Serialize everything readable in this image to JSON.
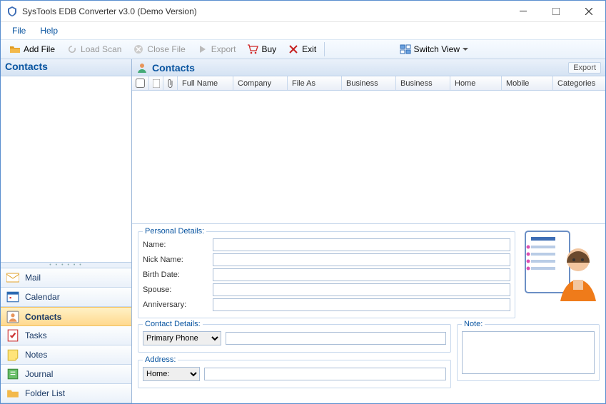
{
  "window": {
    "title": "SysTools EDB Converter v3.0 (Demo Version)"
  },
  "menu": {
    "file": "File",
    "help": "Help"
  },
  "toolbar": {
    "add_file": "Add File",
    "load_scan": "Load Scan",
    "close_file": "Close File",
    "export": "Export",
    "buy": "Buy",
    "exit": "Exit",
    "switch_view": "Switch View"
  },
  "left": {
    "header": "Contacts",
    "nav": [
      {
        "label": "Mail",
        "icon": "mail-icon"
      },
      {
        "label": "Calendar",
        "icon": "calendar-icon"
      },
      {
        "label": "Contacts",
        "icon": "contacts-icon",
        "selected": true
      },
      {
        "label": "Tasks",
        "icon": "tasks-icon"
      },
      {
        "label": "Notes",
        "icon": "notes-icon"
      },
      {
        "label": "Journal",
        "icon": "journal-icon"
      },
      {
        "label": "Folder List",
        "icon": "folder-icon"
      }
    ]
  },
  "right": {
    "header": "Contacts",
    "export_btn": "Export",
    "columns": {
      "full_name": "Full Name",
      "company": "Company",
      "file_as": "File As",
      "business1": "Business",
      "business2": "Business",
      "home": "Home",
      "mobile": "Mobile",
      "categories": "Categories"
    }
  },
  "details": {
    "personal_legend": "Personal Details:",
    "name": "Name:",
    "nick": "Nick Name:",
    "birth": "Birth Date:",
    "spouse": "Spouse:",
    "anniv": "Anniversary:",
    "contact_legend": "Contact Details:",
    "primary_phone": "Primary Phone",
    "address_legend": "Address:",
    "home_opt": "Home:",
    "note_legend": "Note:",
    "values": {
      "name": "",
      "nick": "",
      "birth": "",
      "spouse": "",
      "anniv": "",
      "note": ""
    }
  }
}
